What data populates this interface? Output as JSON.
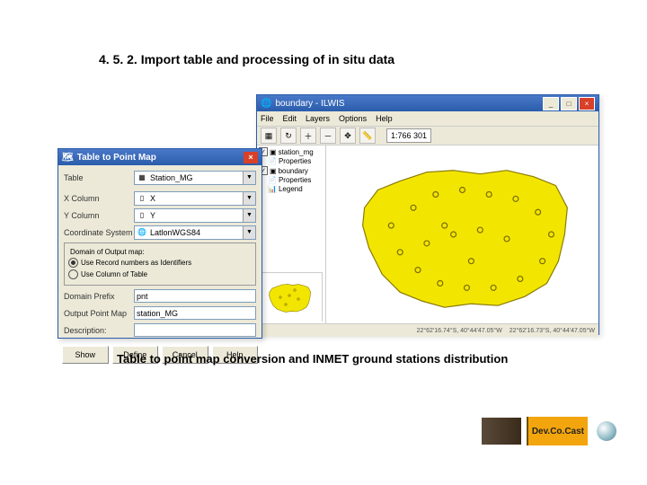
{
  "heading": "4. 5. 2. Import table and processing of in situ data",
  "caption": "Table to point map conversion and INMET ground stations distribution",
  "map_window": {
    "title": "boundary - ILWIS",
    "menu": [
      "File",
      "Edit",
      "Layers",
      "Options",
      "Help"
    ],
    "scale": "1:766 301",
    "layers": {
      "items": [
        {
          "label": "station_mg",
          "indent": 0
        },
        {
          "label": "Properties",
          "indent": 1
        },
        {
          "label": "boundary",
          "indent": 0
        },
        {
          "label": "Properties",
          "indent": 1
        },
        {
          "label": "Legend",
          "indent": 1
        }
      ]
    },
    "status": {
      "left_coord": "22°62'16.74°S, 40°44'47.05°W",
      "right_coord": "22°62'16.73°S, 40°44'47.05°W"
    },
    "win_buttons": {
      "min": "_",
      "max": "□",
      "close": "×"
    }
  },
  "dialog": {
    "title": "Table to Point Map",
    "fields": {
      "table_label": "Table",
      "table_value": "Station_MG",
      "x_label": "X Column",
      "x_value": "X",
      "y_label": "Y Column",
      "y_value": "Y",
      "coord_label": "Coordinate System",
      "coord_value": "LatlonWGS84"
    },
    "group_title": "Domain of Output map:",
    "radio1": "Use Record numbers as Identifiers",
    "radio2": "Use Column of Table",
    "prefix_label": "Domain Prefix",
    "prefix_value": "pnt",
    "output_label": "Output Point Map",
    "output_value": "station_MG",
    "desc_label": "Description:",
    "desc_value": "",
    "buttons": {
      "show": "Show",
      "define": "Define",
      "cancel": "Cancel",
      "help": "Help"
    },
    "close": "×"
  },
  "toolbar": {
    "icons": [
      "layer",
      "redraw",
      "zoom-in",
      "zoom-out",
      "pan",
      "measure"
    ]
  },
  "footer": {
    "brand": "Dev.Co.Cast"
  }
}
